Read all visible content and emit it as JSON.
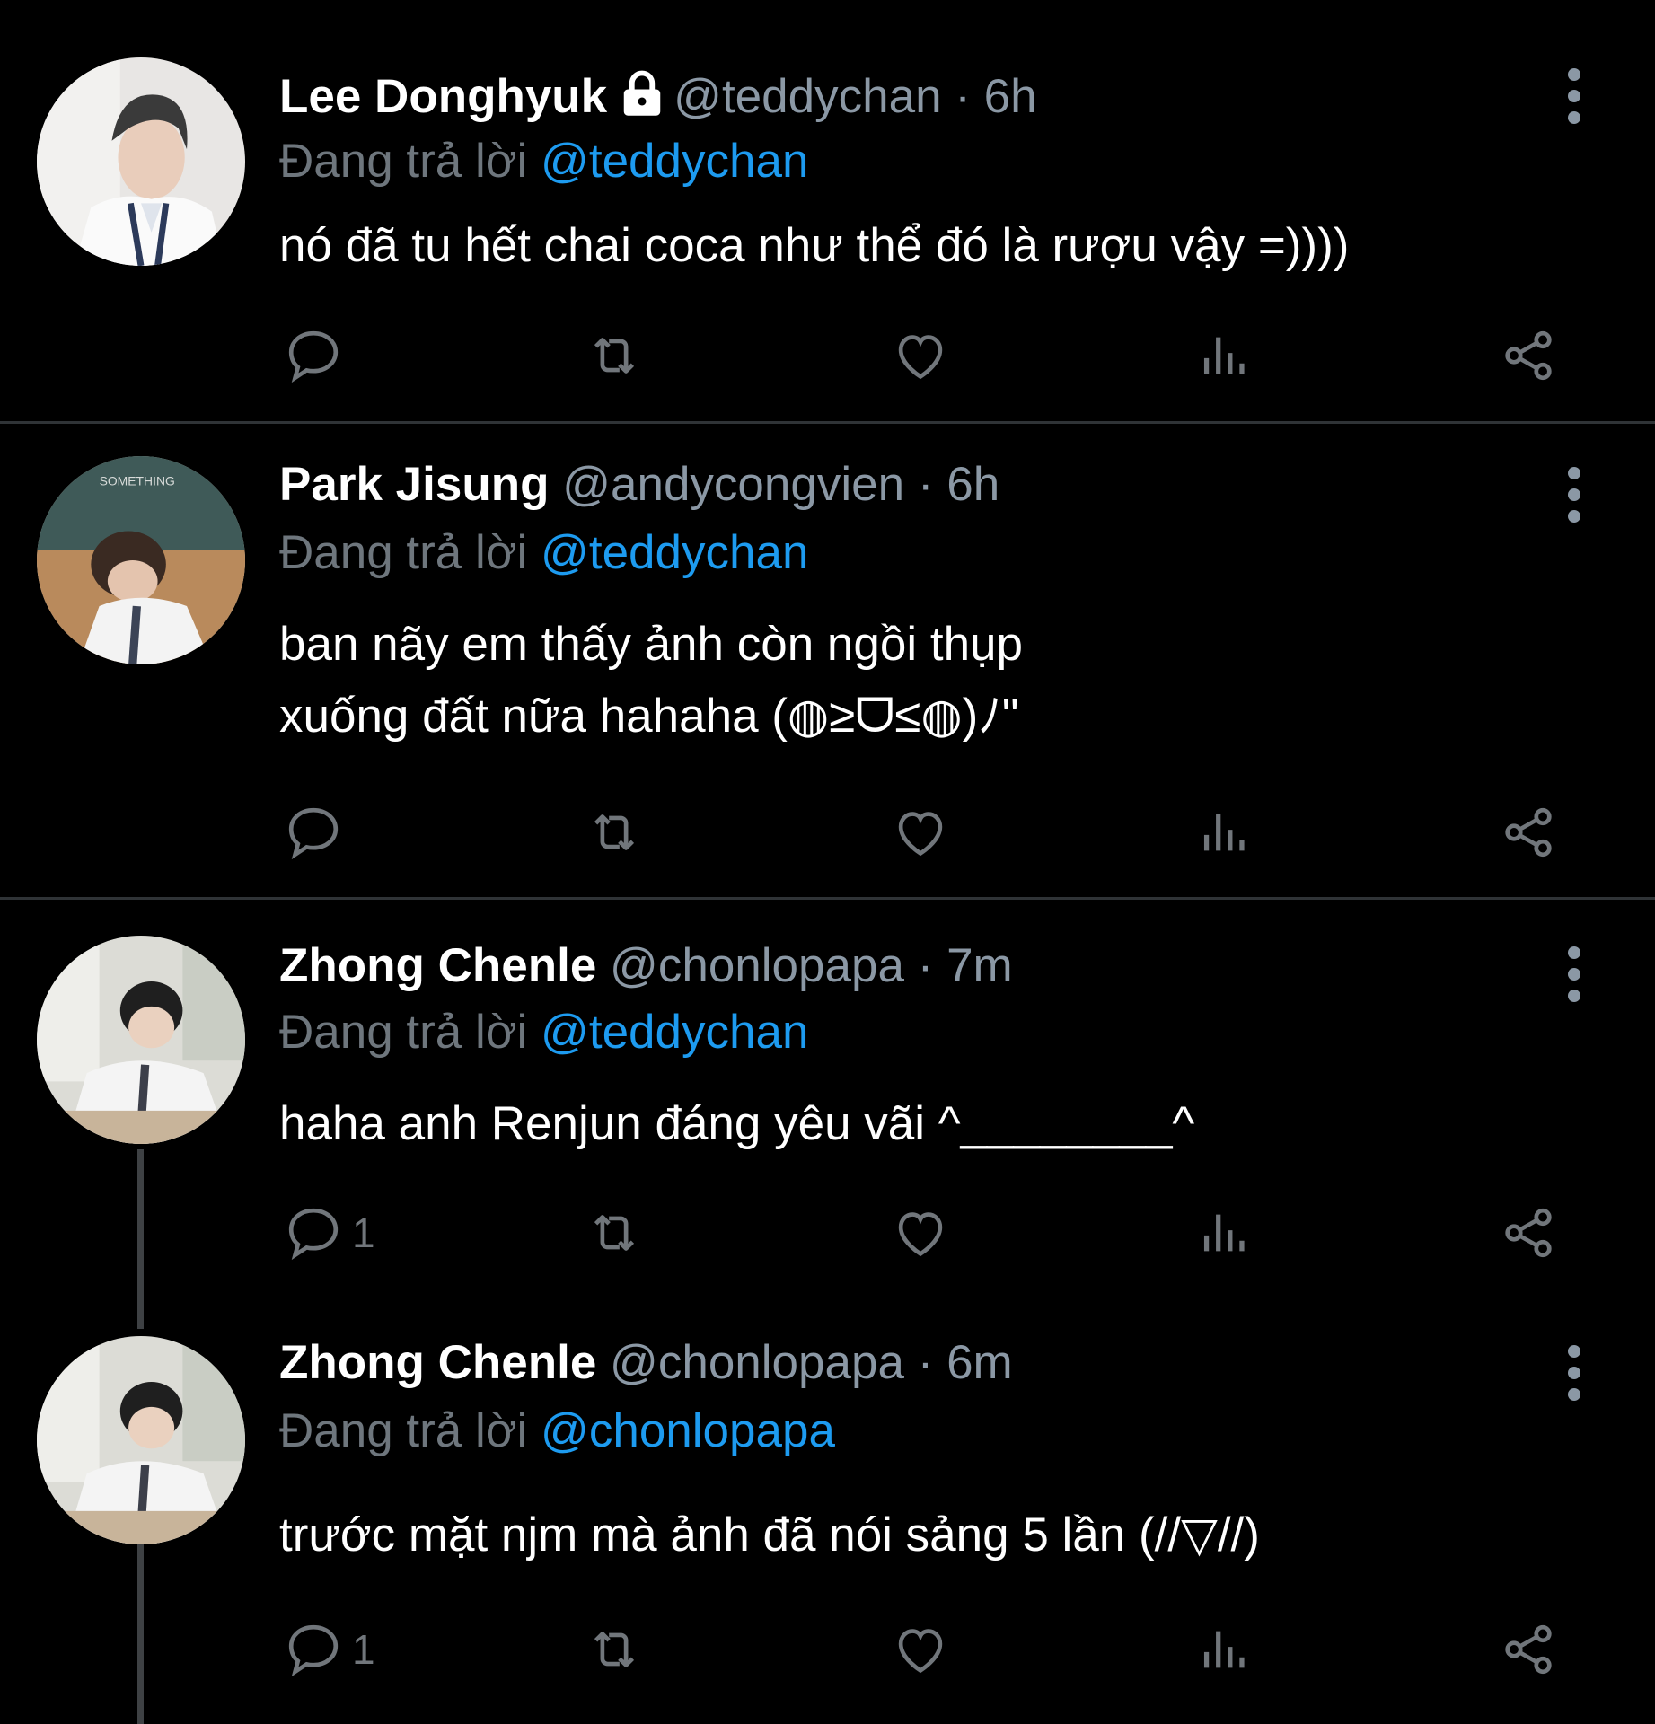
{
  "tweets": [
    {
      "name": "Lee Donghyuk",
      "locked": true,
      "handle": "@teddychan",
      "separator": "·",
      "time": "6h",
      "replying_prefix": "Đang trả lời",
      "replying_to": "@teddychan",
      "text": "nó đã tu hết chai coca như thể đó là rượu vậy =))))",
      "reply_count": ""
    },
    {
      "name": "Park Jisung",
      "locked": false,
      "handle": "@andycongvien",
      "separator": "·",
      "time": "6h",
      "replying_prefix": "Đang trả lời",
      "replying_to": "@teddychan",
      "text": "ban nãy em thấy ảnh còn ngồi thụp\nxuống đất nữa hahaha (◍≥ᗜ≤◍)ﾉ\"",
      "reply_count": ""
    },
    {
      "name": "Zhong Chenle",
      "locked": false,
      "handle": "@chonlopapa",
      "separator": "·",
      "time": "7m",
      "replying_prefix": "Đang trả lời",
      "replying_to": "@teddychan",
      "text": "haha anh Renjun đáng yêu vãi ^________^",
      "reply_count": "1"
    },
    {
      "name": "Zhong Chenle",
      "locked": false,
      "handle": "@chonlopapa",
      "separator": "·",
      "time": "6m",
      "replying_prefix": "Đang trả lời",
      "replying_to": "@chonlopapa",
      "text": "trước mặt njm mà ảnh đã nói sảng 5 lần (//▽//)",
      "reply_count": "1"
    }
  ],
  "icons": {
    "reply": "reply-icon",
    "retweet": "retweet-icon",
    "like": "heart-icon",
    "views": "analytics-icon",
    "share": "share-icon",
    "more": "more-vertical-icon",
    "lock": "lock-icon"
  },
  "colors": {
    "background": "#000000",
    "name": "#ffffff",
    "secondary": "#8b98a5",
    "mention": "#1d9bf0",
    "divider": "#2f3336"
  }
}
